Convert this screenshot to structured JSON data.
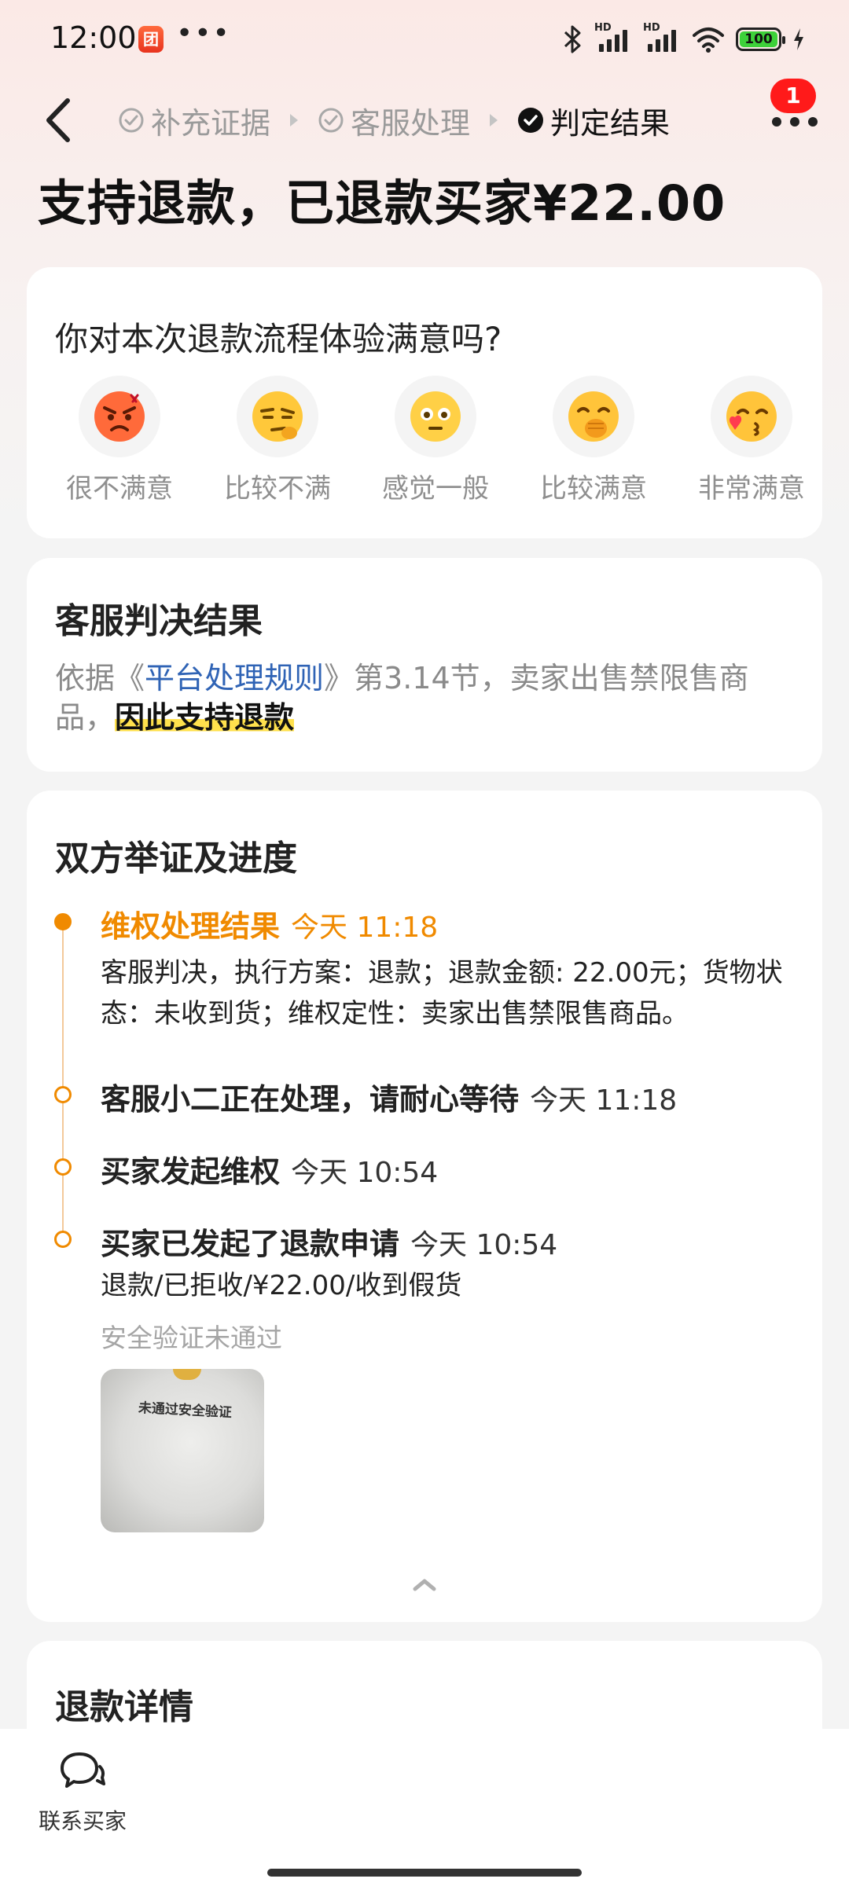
{
  "status_bar": {
    "time": "12:00",
    "app_icon_text": "团",
    "overflow_dots": "•••",
    "hd_label": "HD",
    "battery": "100"
  },
  "nav": {
    "steps": [
      {
        "label": "补充证据",
        "state": "done"
      },
      {
        "label": "客服处理",
        "state": "done"
      },
      {
        "label": "判定结果",
        "state": "current"
      }
    ],
    "badge_count": "1"
  },
  "headline": "支持退款，已退款买家¥22.00",
  "satisfaction": {
    "question": "你对本次退款流程体验满意吗?",
    "options": [
      {
        "label": "很不满意",
        "icon": "angry-face-icon"
      },
      {
        "label": "比较不满",
        "icon": "skeptical-face-icon"
      },
      {
        "label": "感觉一般",
        "icon": "neutral-face-icon"
      },
      {
        "label": "比较满意",
        "icon": "giggle-face-icon"
      },
      {
        "label": "非常满意",
        "icon": "kiss-face-icon"
      }
    ]
  },
  "verdict": {
    "title": "客服判决结果",
    "prefix": "依据《",
    "rule_link": "平台处理规则",
    "middle": "》第3.14节，卖家出售禁限售商品，",
    "conclusion": "因此支持退款"
  },
  "progress": {
    "title": "双方举证及进度",
    "events": [
      {
        "title": "维权处理结果",
        "time": "今天 11:18",
        "desc": "客服判决，执行方案：退款；退款金额: 22.00元；货物状态：未收到货；维权定性：卖家出售禁限售商品。"
      },
      {
        "title": "客服小二正在处理，请耐心等待",
        "time": "今天 11:18"
      },
      {
        "title": "买家发起维权",
        "time": "今天 10:54"
      },
      {
        "title": "买家已发起了退款申请",
        "time": "今天 10:54",
        "desc": "退款/已拒收/¥22.00/收到假货",
        "note": "安全验证未通过",
        "image_text": "未通过安全验证"
      }
    ]
  },
  "refund_detail": {
    "title": "退款详情"
  },
  "bottom_bar": {
    "contact_label": "联系买家"
  },
  "colors": {
    "accent_orange": "#f08a00",
    "link_blue": "#2f63b5",
    "badge_red": "#ff1a1a",
    "highlight_yellow": "#ffe14d",
    "battery_green": "#3dd13a"
  }
}
